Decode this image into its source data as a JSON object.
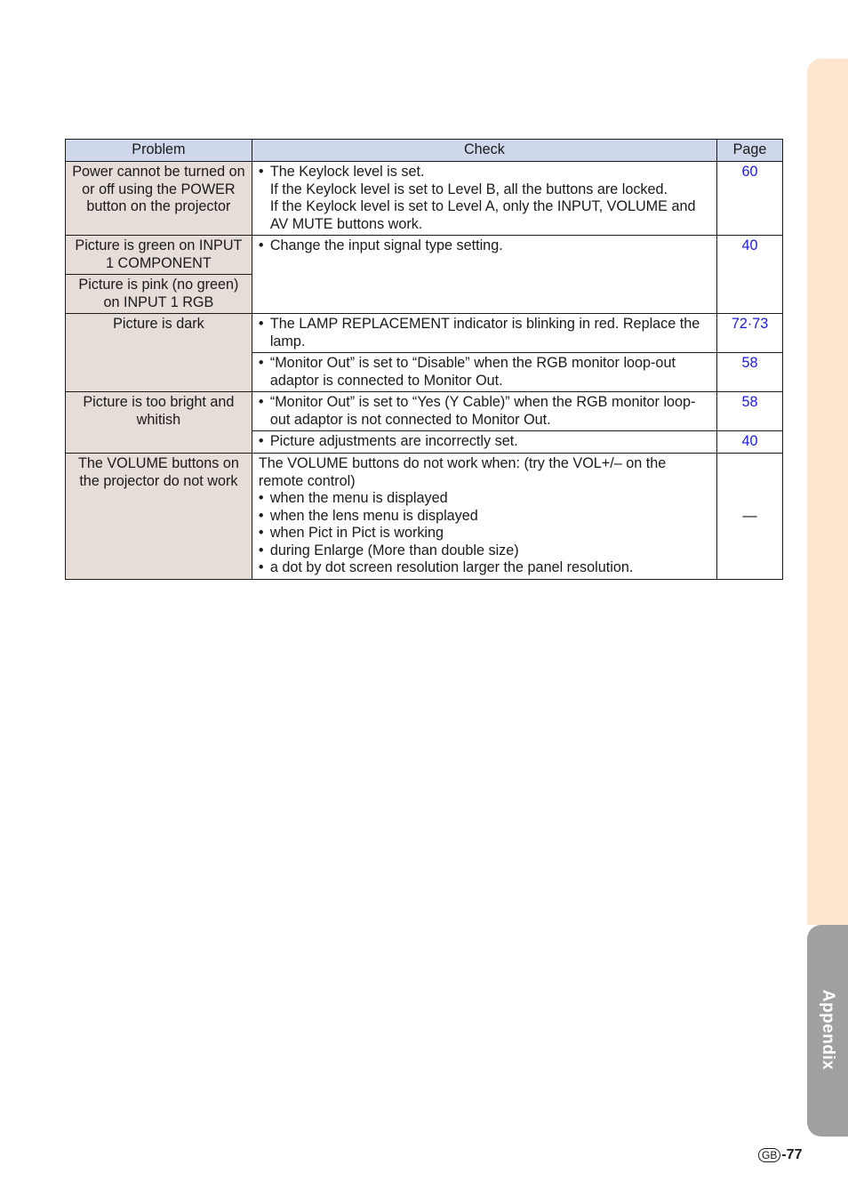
{
  "side_tabs": {
    "appendix_label": "Appendix"
  },
  "table": {
    "headers": {
      "problem": "Problem",
      "check": "Check",
      "page": "Page"
    },
    "rows": [
      {
        "problem": "Power cannot be turned on or off using the POWER button on the projector",
        "check_bullet": "The Keylock level is set.",
        "check_lines": [
          "If the Keylock level is set to Level B, all the buttons are locked.",
          "If the Keylock level is set to Level A, only the INPUT, VOLUME and AV MUTE buttons work."
        ],
        "page": "60"
      },
      {
        "problems": [
          "Picture is green on INPUT 1 COMPONENT",
          "Picture is pink (no green) on INPUT 1 RGB"
        ],
        "check_bullet": "Change the input signal type setting.",
        "page": "40"
      },
      {
        "problem": "Picture is dark",
        "checks": [
          {
            "text": "The LAMP REPLACEMENT indicator is blinking in red. Replace the lamp.",
            "page": "72·73"
          },
          {
            "text": "“Monitor Out” is set to “Disable” when the RGB monitor loop-out adaptor is connected to Monitor Out.",
            "page": "58"
          }
        ]
      },
      {
        "problem": "Picture is too bright and whitish",
        "checks": [
          {
            "text": "“Monitor Out” is set to “Yes (Y Cable)” when the RGB monitor loop-out adaptor is not connected to Monitor Out.",
            "page": "58"
          },
          {
            "text": "Picture adjustments are incorrectly set.",
            "page": "40"
          }
        ]
      },
      {
        "problem": "The VOLUME buttons on the projector do not work",
        "check_intro": "The VOLUME buttons do not work when: (try the VOL+/– on the remote control)",
        "check_bullets": [
          "when the menu is displayed",
          "when the lens menu is displayed",
          "when Pict in Pict is working",
          "during Enlarge (More than double size)",
          "a dot by dot screen resolution larger the panel resolution."
        ],
        "page": "—"
      }
    ]
  },
  "footer": {
    "region_badge": "GB",
    "page_number": "-77"
  },
  "colors": {
    "header_bg": "#cfd8ea",
    "problem_bg": "#e6ddd8",
    "page_link": "#1a1ae6",
    "side_tab_top": "#fde5d0",
    "side_tab_bottom": "#a0a0a0"
  }
}
